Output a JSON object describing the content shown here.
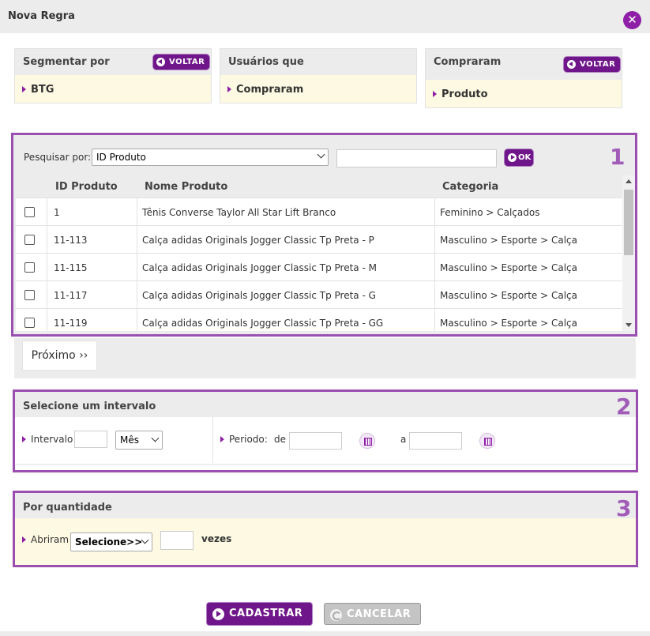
{
  "dialog": {
    "title": "Nova Regra",
    "close_glyph": "✕"
  },
  "crumbs": [
    {
      "label": "Segmentar por",
      "value": "BTG",
      "back": "VOLTAR"
    },
    {
      "label": "Usuários que",
      "value": "Compraram",
      "back": ""
    },
    {
      "label": "Compraram",
      "value": "Produto",
      "back": "VOLTAR"
    }
  ],
  "product_search": {
    "number": "1",
    "label": "Pesquisar por:",
    "field_selected": "ID Produto",
    "query_value": "",
    "ok_label": "OK",
    "columns": [
      "ID Produto",
      "Nome Produto",
      "Categoria"
    ],
    "rows": [
      {
        "checked": false,
        "id": "1",
        "name": "Tênis Converse Taylor All Star Lift Branco",
        "category": "Feminino > Calçados"
      },
      {
        "checked": false,
        "id": "11-113",
        "name": "Calça adidas Originals Jogger Classic Tp Preta - P",
        "category": "Masculino > Esporte > Calça"
      },
      {
        "checked": false,
        "id": "11-115",
        "name": "Calça adidas Originals Jogger Classic Tp Preta - M",
        "category": "Masculino > Esporte > Calça"
      },
      {
        "checked": false,
        "id": "11-117",
        "name": "Calça adidas Originals Jogger Classic Tp Preta - G",
        "category": "Masculino > Esporte > Calça"
      },
      {
        "checked": false,
        "id": "11-119",
        "name": "Calça adidas Originals Jogger Classic Tp Preta - GG",
        "category": "Masculino > Esporte > Calça"
      }
    ],
    "next_label": "Próximo ››"
  },
  "interval": {
    "number": "2",
    "title": "Selecione um intervalo",
    "interval_label": "Intervalo",
    "interval_value": "",
    "unit_selected": "Mês",
    "period_label": "Periodo:",
    "from_label": "de",
    "from_value": "",
    "to_label": "a",
    "to_value": ""
  },
  "quantity": {
    "number": "3",
    "title": "Por quantidade",
    "opened_label": "Abriram",
    "select_value": "Selecione>>",
    "count_value": "",
    "times_label": "vezes"
  },
  "actions": {
    "submit_label": "CADASTRAR",
    "cancel_label": "CANCELAR"
  },
  "colors": {
    "accent": "#6f178a",
    "border_accent": "#9b4fb0",
    "panel_bg": "#ececec",
    "highlight_bg": "#fdf9e2"
  }
}
